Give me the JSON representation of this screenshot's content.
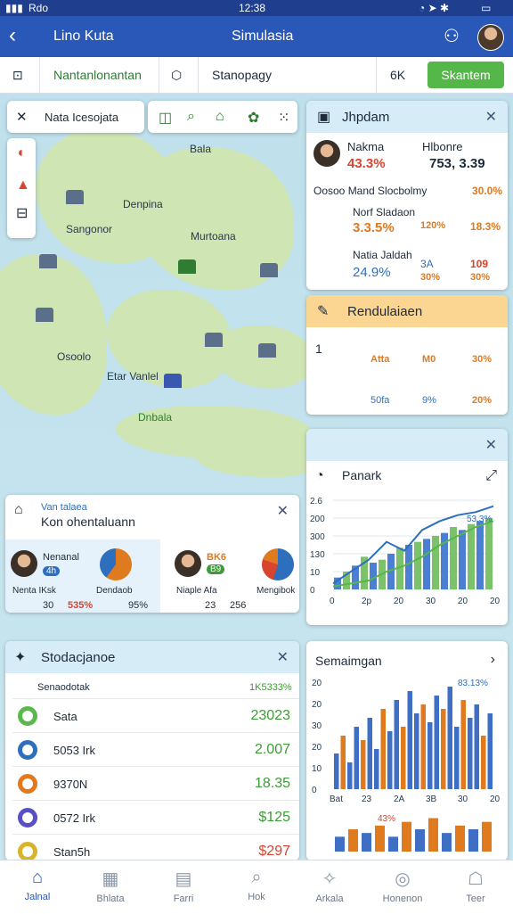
{
  "status_bar": {
    "carrier": "Rdo",
    "time": "12:38"
  },
  "header": {
    "title_left": "Lino Kuta",
    "title_center": "Simulasia"
  },
  "toolbar": {
    "item1": "Nantanlonantan",
    "item2": "Stanopagy",
    "item3": "6K",
    "action": "Skantem"
  },
  "map": {
    "search_label": "Nata Icesojata",
    "labels": [
      "Bala",
      "Denpina",
      "Sangonor",
      "Murtoana",
      "Osoolo",
      "Etar Vanlel",
      "Dnbala"
    ]
  },
  "panel_a": {
    "title": "Jhpdam",
    "person1": {
      "name": "Nakma",
      "value": "43.3%"
    },
    "person2": {
      "name": "Hlbonre",
      "value": "753, 3.39"
    },
    "summary": {
      "text": "Oosoo Mand Slocbolmy",
      "value": "30.0%"
    },
    "rows": [
      {
        "label": "Norf Sladaon",
        "value": "3.3.5%",
        "v2": "120%",
        "v3": "18.3%"
      },
      {
        "label": "Natia Jaldah",
        "value": "24.9%",
        "v2": "3A",
        "v2b": "30%",
        "v3": "109",
        "v3b": "30%"
      }
    ]
  },
  "panel_b": {
    "title": "Rendulaiaen",
    "cells": [
      {
        "label": "Atta",
        "sub": "1"
      },
      {
        "label": "M0"
      },
      {
        "label": "30%"
      },
      {
        "label": "50fa"
      },
      {
        "label": "9%"
      },
      {
        "label": "20%"
      }
    ]
  },
  "panel_c": {
    "title": "Panark",
    "chart_data": {
      "type": "line",
      "series": [
        {
          "values": [
            20,
            60,
            100,
            160,
            130,
            200,
            230,
            250,
            260,
            280
          ]
        },
        {
          "values": [
            10,
            20,
            30,
            60,
            80,
            110,
            150,
            180,
            210,
            230
          ]
        }
      ],
      "bars": [
        40,
        60,
        80,
        110,
        90,
        100,
        120,
        140,
        150,
        160,
        170,
        180,
        190,
        210,
        200,
        220,
        230,
        240
      ],
      "yticks": [
        "2.6",
        "200",
        "300",
        "130",
        "10",
        "0"
      ],
      "xticks": [
        "0",
        "2p",
        "20",
        "30",
        "20",
        "20"
      ],
      "annotation": "53.3%"
    }
  },
  "panel_d": {
    "title": "Van talaea",
    "subtitle": "Kon ohentaluann",
    "card1": {
      "name": "Nenanal",
      "pill": "4h",
      "row_label": "Nenta IKsk",
      "row_label2": "Dendaob",
      "s1": "30",
      "s2": "535%",
      "s3": "95%"
    },
    "card2": {
      "badge": "BK6",
      "badge2": "B9",
      "name": "Niaple Afa",
      "row_label": "Mengibok",
      "s1": "23",
      "s2": "256"
    }
  },
  "panel_e": {
    "title": "Stodacjanoe",
    "header": {
      "label": "Senaodotak",
      "value": "1K5333%"
    },
    "rows": [
      {
        "label": "Sata",
        "value": "23023",
        "color": "#3d9a36"
      },
      {
        "label": "5053 Irk",
        "value": "2.007",
        "color": "#3d9a36"
      },
      {
        "label": "9370N",
        "value": "18.35",
        "color": "#3d9a36"
      },
      {
        "label": "0572 Irk",
        "value": "$125",
        "color": "#3d9a36"
      },
      {
        "label": "Stan5h",
        "value": "$297",
        "color": "#d8442f"
      }
    ]
  },
  "panel_f": {
    "title": "Semaimgan",
    "chart_data": {
      "type": "bar",
      "yticks": [
        "20",
        "20",
        "30",
        "20",
        "10",
        "0"
      ],
      "xticks": [
        "Bat",
        "23",
        "2A",
        "3B",
        "30",
        "20"
      ],
      "annotation": "83.13%",
      "annotation2": "43%"
    }
  },
  "bottom_nav": [
    {
      "label": "Jalnal",
      "active": true
    },
    {
      "label": "Bhlata"
    },
    {
      "label": "Farri"
    },
    {
      "label": "Hok"
    },
    {
      "label": "Arkala"
    },
    {
      "label": "Honenon"
    },
    {
      "label": "Teer"
    }
  ]
}
